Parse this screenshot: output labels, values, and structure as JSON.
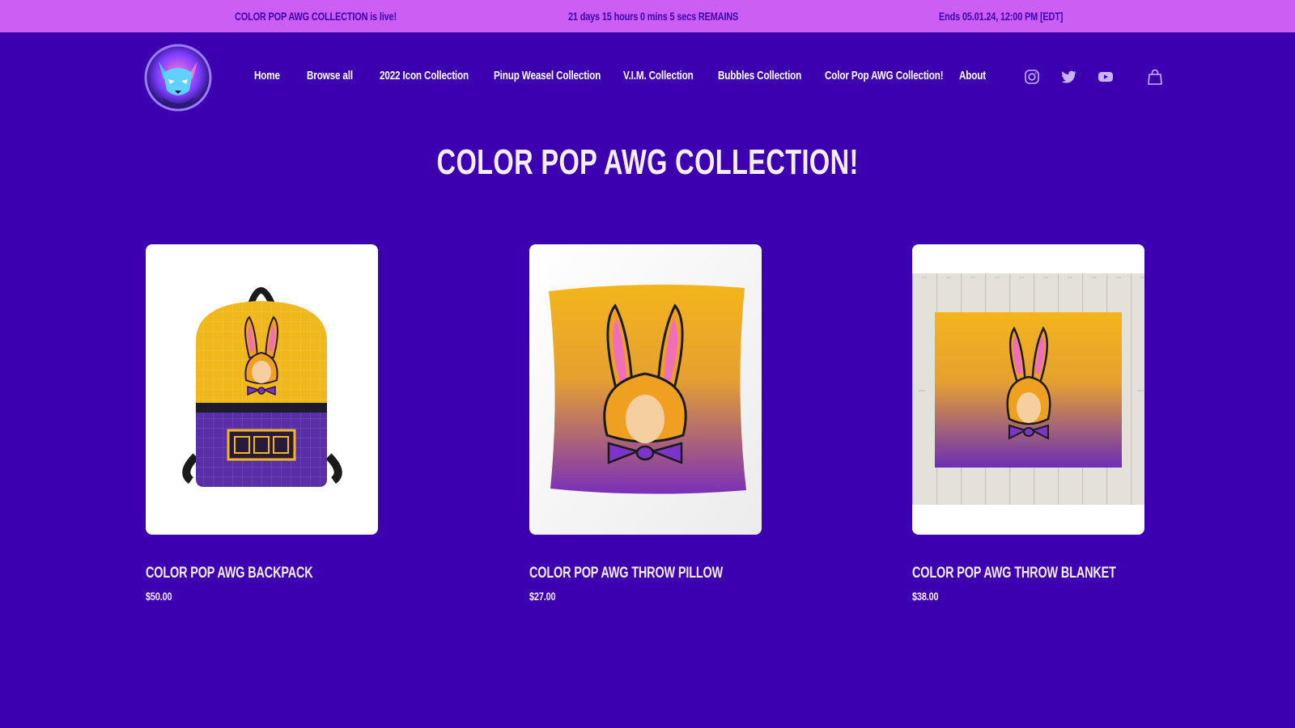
{
  "announcement": {
    "live_text": "COLOR POP AWG COLLECTION is live!",
    "countdown_text": "21 days 15 hours 0 mins 5 secs REMAINS",
    "ends_text": "Ends 05.01.24, 12:00 PM [EDT]"
  },
  "header": {
    "logo_icon": "fox-mascot-logo",
    "nav": [
      {
        "label": "Home"
      },
      {
        "label": "Browse all"
      },
      {
        "label": "2022 Icon Collection"
      },
      {
        "label": "Pinup Weasel Collection"
      },
      {
        "label": "V.I.M. Collection"
      },
      {
        "label": "Bubbles Collection"
      },
      {
        "label": "Color Pop AWG Collection!"
      },
      {
        "label": "About"
      }
    ],
    "social_icons": [
      "instagram-icon",
      "twitter-icon",
      "youtube-icon"
    ],
    "cart_icon": "shopping-bag-icon"
  },
  "main": {
    "title": "COLOR POP AWG COLLECTION!",
    "products": [
      {
        "name": "COLOR POP AWG BACKPACK",
        "price": "$50.00"
      },
      {
        "name": "COLOR POP AWG THROW PILLOW",
        "price": "$27.00"
      },
      {
        "name": "COLOR POP AWG THROW BLANKET",
        "price": "$38.00"
      }
    ]
  },
  "colors": {
    "background": "#3d00b1",
    "announcement_bar": "#cc5ef3",
    "text_light": "#f4ecff",
    "accent_yellow": "#f3b51c",
    "accent_purple": "#6b2fb5"
  }
}
